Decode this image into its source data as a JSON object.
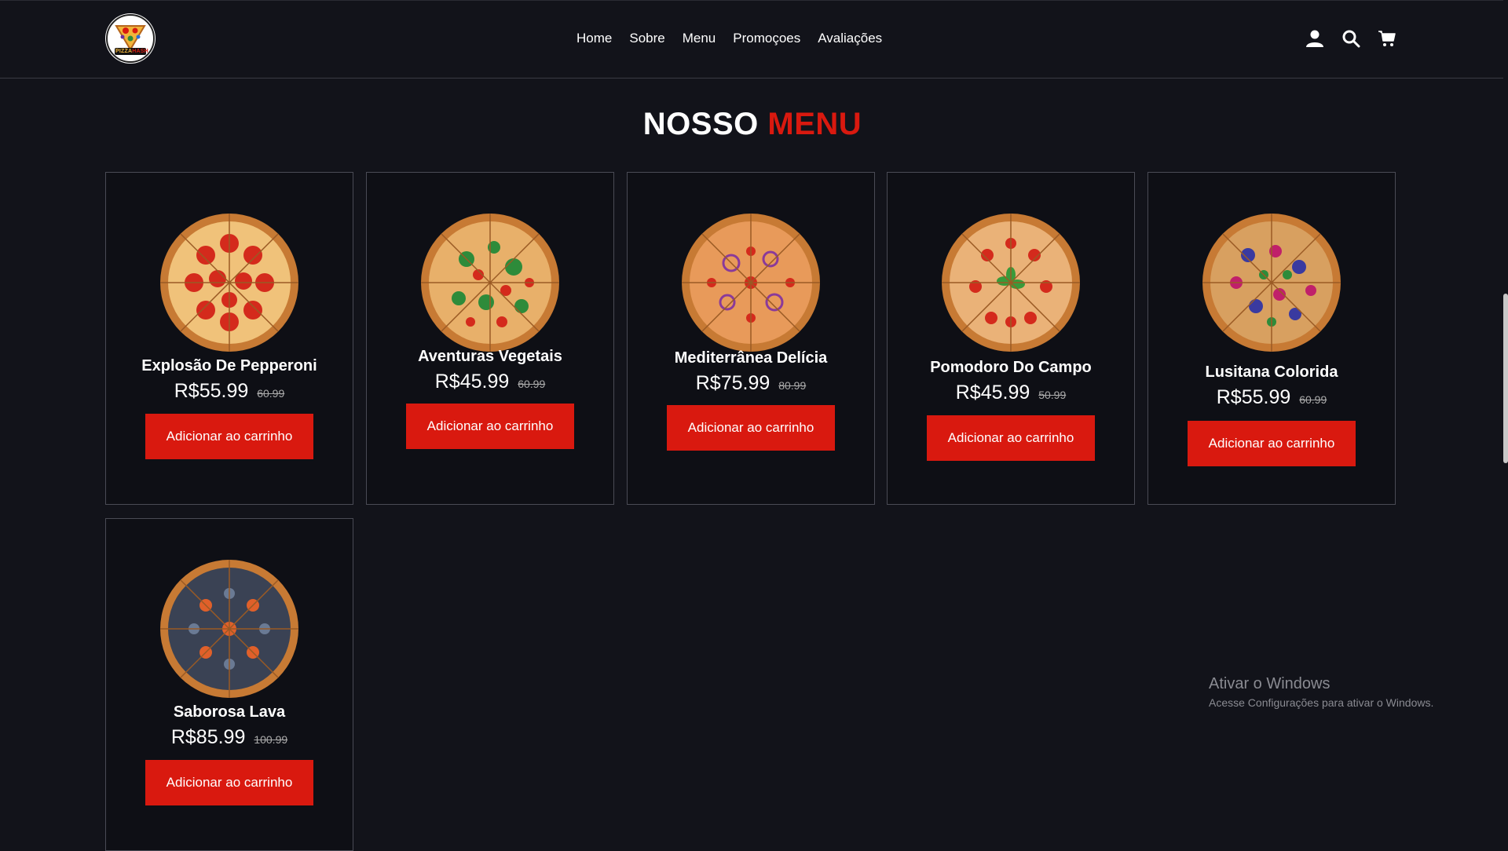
{
  "nav": {
    "links": [
      "Home",
      "Sobre",
      "Menu",
      "Promoçoes",
      "Avaliações"
    ],
    "icons": [
      "user-icon",
      "search-icon",
      "cart-icon"
    ]
  },
  "logo": {
    "text_a": "PIZZA",
    "text_b": "HASH"
  },
  "section": {
    "title_a": "NOSSO",
    "title_b": "MENU"
  },
  "colors": {
    "accent": "#d9190f",
    "background": "#12131a",
    "card_bg": "#0e0f15"
  },
  "products": [
    {
      "name": "Explosão De Pepperoni",
      "price": "R$55.99",
      "old_price": "60.99",
      "button": "Adicionar ao carrinho",
      "topping": "pepperoni"
    },
    {
      "name": "Aventuras Vegetais",
      "price": "R$45.99",
      "old_price": "60.99",
      "button": "Adicionar ao carrinho",
      "topping": "vegetables"
    },
    {
      "name": "Mediterrânea Delícia",
      "price": "R$75.99",
      "old_price": "80.99",
      "button": "Adicionar ao carrinho",
      "topping": "mediterranean"
    },
    {
      "name": "Pomodoro Do Campo",
      "price": "R$45.99",
      "old_price": "50.99",
      "button": "Adicionar ao carrinho",
      "topping": "tomato-basil"
    },
    {
      "name": "Lusitana Colorida",
      "price": "R$55.99",
      "old_price": "60.99",
      "button": "Adicionar ao carrinho",
      "topping": "berries"
    },
    {
      "name": "Saborosa Lava",
      "price": "R$85.99",
      "old_price": "100.99",
      "button": "Adicionar ao carrinho",
      "topping": "lava"
    }
  ],
  "watermark": {
    "title": "Ativar o Windows",
    "subtitle": "Acesse Configurações para ativar o Windows."
  }
}
